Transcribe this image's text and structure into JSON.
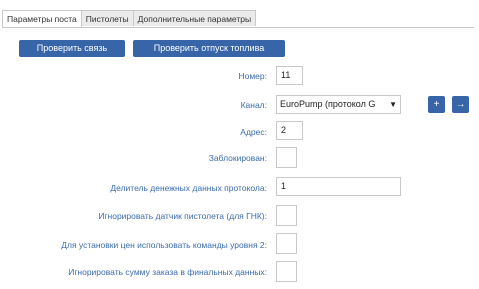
{
  "tabs": [
    "Параметры поста",
    "Пистолеты",
    "Дополнительные параметры"
  ],
  "buttons": {
    "check_connection": "Проверить связь",
    "check_fuel": "Проверить отпуск топлива"
  },
  "fields": {
    "number": {
      "label": "Номер:",
      "value": "11"
    },
    "channel": {
      "label": "Канал:",
      "value": "EuroPump (протокол G"
    },
    "address": {
      "label": "Адрес:",
      "value": "2"
    },
    "blocked": {
      "label": "Заблокирован:"
    },
    "divider": {
      "label": "Делитель денежных данных протокола:",
      "value": "1"
    },
    "ignore_sensor": {
      "label": "Игнорировать датчик пистолета (для ГНК):"
    },
    "level2": {
      "label": "Для установки цен использовать команды уровня 2:"
    },
    "ignore_sum": {
      "label": "Игнорировать сумму заказа в финальных данных:"
    }
  },
  "icons": {
    "add": "+",
    "goto": "→"
  }
}
